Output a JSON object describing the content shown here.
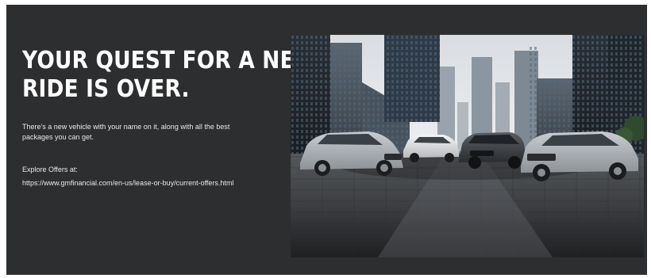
{
  "banner": {
    "headline_line1": "YOUR QUEST FOR A NEW",
    "headline_line2": "RIDE IS OVER.",
    "subtext_line1": "There's a new vehicle with your name on it, along with all the best",
    "subtext_line2": "packages you can get.",
    "explore_label": "Explore Offers at:",
    "explore_url": "https://www.gmfinancial.com/en-us/lease-or-buy/current-offers.html"
  },
  "colors": {
    "panel_background": "#2d2e30",
    "text": "#ffffff"
  },
  "hero_image": {
    "description_icon": "city-street-with-four-suvs-photo"
  }
}
